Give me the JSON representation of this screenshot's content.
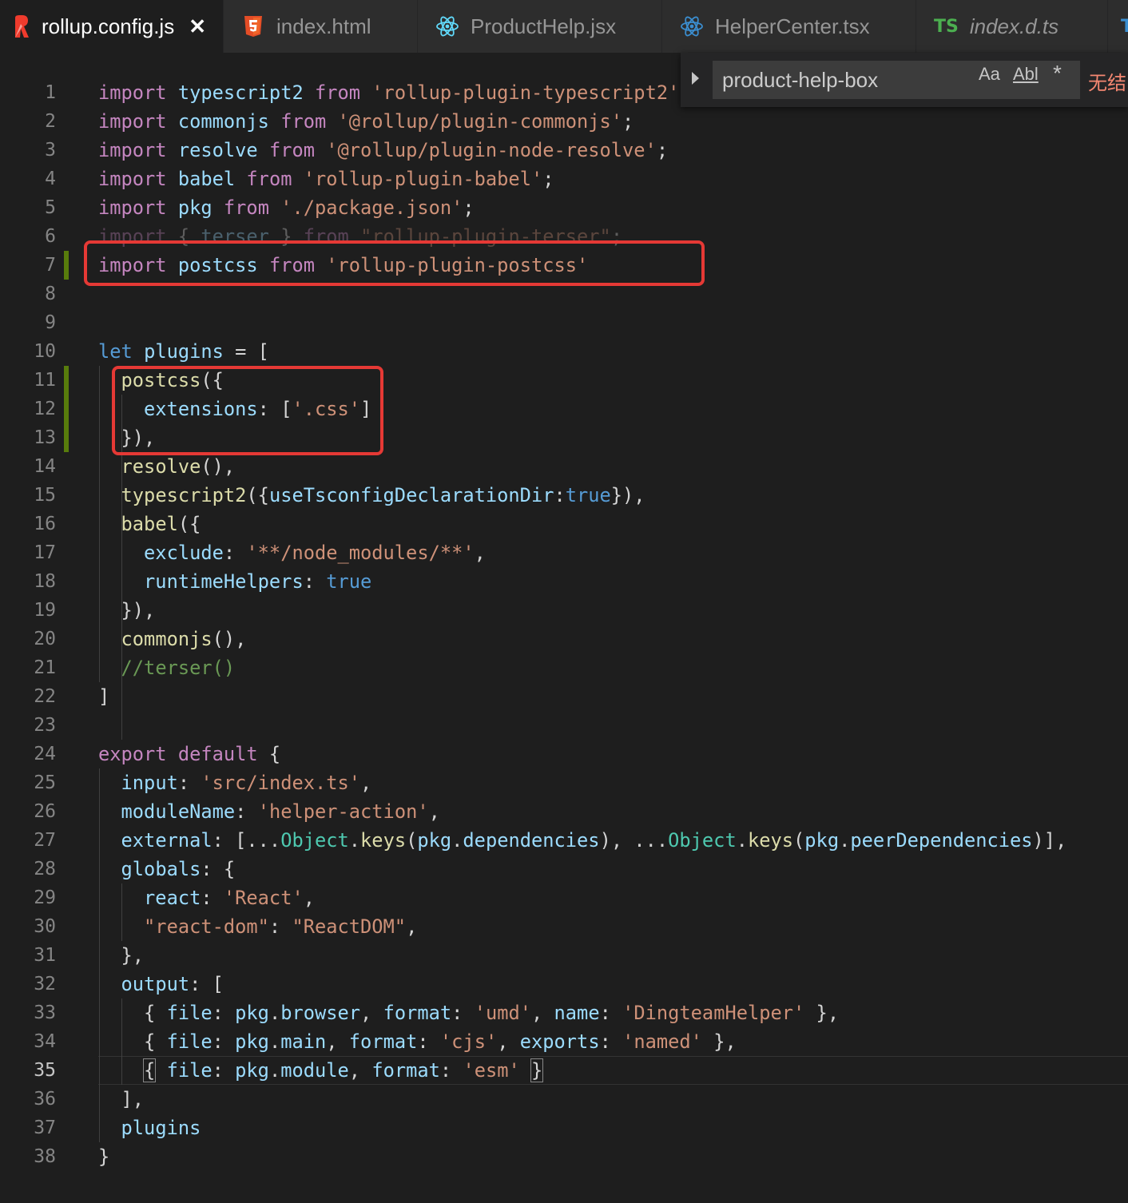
{
  "tabs": [
    {
      "label": "rollup.config.js",
      "icon": "rollup-icon",
      "active": true,
      "close": "✕"
    },
    {
      "label": "index.html",
      "icon": "html5-icon",
      "active": false
    },
    {
      "label": "ProductHelp.jsx",
      "icon": "react-icon",
      "active": false
    },
    {
      "label": "HelperCenter.tsx",
      "icon": "react-icon",
      "active": false
    },
    {
      "label": "index.d.ts",
      "icon": "typescript-icon",
      "badge": "TS",
      "active": false
    },
    {
      "label": "",
      "icon": "typescript-icon",
      "badge": "T",
      "active": false
    }
  ],
  "find": {
    "query": "product-help-box",
    "match_case": "Aa",
    "whole_word": "Abl",
    "regex": "*",
    "result": "无结"
  },
  "lines": [
    {
      "n": "1"
    },
    {
      "n": "2"
    },
    {
      "n": "3"
    },
    {
      "n": "4"
    },
    {
      "n": "5"
    },
    {
      "n": "6"
    },
    {
      "n": "7"
    },
    {
      "n": "8"
    },
    {
      "n": "9"
    },
    {
      "n": "10"
    },
    {
      "n": "11"
    },
    {
      "n": "12"
    },
    {
      "n": "13"
    },
    {
      "n": "14"
    },
    {
      "n": "15"
    },
    {
      "n": "16"
    },
    {
      "n": "17"
    },
    {
      "n": "18"
    },
    {
      "n": "19"
    },
    {
      "n": "20"
    },
    {
      "n": "21"
    },
    {
      "n": "22"
    },
    {
      "n": "23"
    },
    {
      "n": "24"
    },
    {
      "n": "25"
    },
    {
      "n": "26"
    },
    {
      "n": "27"
    },
    {
      "n": "28"
    },
    {
      "n": "29"
    },
    {
      "n": "30"
    },
    {
      "n": "31"
    },
    {
      "n": "32"
    },
    {
      "n": "33"
    },
    {
      "n": "34"
    },
    {
      "n": "35"
    },
    {
      "n": "36"
    },
    {
      "n": "37"
    },
    {
      "n": "38"
    }
  ],
  "current_line": 35,
  "code": [
    [
      [
        "k",
        "import"
      ],
      [
        "p",
        " "
      ],
      [
        "v",
        "typescript2"
      ],
      [
        "p",
        " "
      ],
      [
        "k",
        "from"
      ],
      [
        "p",
        " "
      ],
      [
        "s",
        "'rollup-plugin-typescript2'"
      ]
    ],
    [
      [
        "k",
        "import"
      ],
      [
        "p",
        " "
      ],
      [
        "v",
        "commonjs"
      ],
      [
        "p",
        " "
      ],
      [
        "k",
        "from"
      ],
      [
        "p",
        " "
      ],
      [
        "s",
        "'@rollup/plugin-commonjs'"
      ],
      [
        "p",
        ";"
      ]
    ],
    [
      [
        "k",
        "import"
      ],
      [
        "p",
        " "
      ],
      [
        "v",
        "resolve"
      ],
      [
        "p",
        " "
      ],
      [
        "k",
        "from"
      ],
      [
        "p",
        " "
      ],
      [
        "s",
        "'@rollup/plugin-node-resolve'"
      ],
      [
        "p",
        ";"
      ]
    ],
    [
      [
        "k",
        "import"
      ],
      [
        "p",
        " "
      ],
      [
        "v",
        "babel"
      ],
      [
        "p",
        " "
      ],
      [
        "k",
        "from"
      ],
      [
        "p",
        " "
      ],
      [
        "s",
        "'rollup-plugin-babel'"
      ],
      [
        "p",
        ";"
      ]
    ],
    [
      [
        "k",
        "import"
      ],
      [
        "p",
        " "
      ],
      [
        "v",
        "pkg"
      ],
      [
        "p",
        " "
      ],
      [
        "k",
        "from"
      ],
      [
        "p",
        " "
      ],
      [
        "s",
        "'./package.json'"
      ],
      [
        "p",
        ";"
      ]
    ],
    [
      [
        "k",
        "import"
      ],
      [
        "p",
        " { "
      ],
      [
        "v",
        "terser"
      ],
      [
        "p",
        " } "
      ],
      [
        "k",
        "from"
      ],
      [
        "p",
        " "
      ],
      [
        "s",
        "\"rollup-plugin-terser\""
      ],
      [
        "p",
        ";"
      ]
    ],
    [
      [
        "k",
        "import"
      ],
      [
        "p",
        " "
      ],
      [
        "v",
        "postcss"
      ],
      [
        "p",
        " "
      ],
      [
        "k",
        "from"
      ],
      [
        "p",
        " "
      ],
      [
        "s",
        "'rollup-plugin-postcss'"
      ]
    ],
    [],
    [],
    [
      [
        "kb",
        "let"
      ],
      [
        "p",
        " "
      ],
      [
        "v",
        "plugins"
      ],
      [
        "p",
        " = ["
      ]
    ],
    [
      [
        "p",
        "  "
      ],
      [
        "f",
        "postcss"
      ],
      [
        "p",
        "({"
      ]
    ],
    [
      [
        "p",
        "    "
      ],
      [
        "v",
        "extensions"
      ],
      [
        "p",
        ": ["
      ],
      [
        "s",
        "'.css'"
      ],
      [
        "p",
        "]"
      ]
    ],
    [
      [
        "p",
        "  }),"
      ]
    ],
    [
      [
        "p",
        "  "
      ],
      [
        "f",
        "resolve"
      ],
      [
        "p",
        "(),"
      ]
    ],
    [
      [
        "p",
        "  "
      ],
      [
        "f",
        "typescript2"
      ],
      [
        "p",
        "({"
      ],
      [
        "v",
        "useTsconfigDeclarationDir"
      ],
      [
        "p",
        ":"
      ],
      [
        "kb",
        "true"
      ],
      [
        "p",
        "}),"
      ]
    ],
    [
      [
        "p",
        "  "
      ],
      [
        "f",
        "babel"
      ],
      [
        "p",
        "({"
      ]
    ],
    [
      [
        "p",
        "    "
      ],
      [
        "v",
        "exclude"
      ],
      [
        "p",
        ": "
      ],
      [
        "s",
        "'**/node_modules/**'"
      ],
      [
        "p",
        ","
      ]
    ],
    [
      [
        "p",
        "    "
      ],
      [
        "v",
        "runtimeHelpers"
      ],
      [
        "p",
        ": "
      ],
      [
        "kb",
        "true"
      ]
    ],
    [
      [
        "p",
        "  }),"
      ]
    ],
    [
      [
        "p",
        "  "
      ],
      [
        "f",
        "commonjs"
      ],
      [
        "p",
        "(),"
      ]
    ],
    [
      [
        "p",
        "  "
      ],
      [
        "c",
        "//terser()"
      ]
    ],
    [
      [
        "p",
        "]"
      ]
    ],
    [],
    [
      [
        "k",
        "export"
      ],
      [
        "p",
        " "
      ],
      [
        "k",
        "default"
      ],
      [
        "p",
        " {"
      ]
    ],
    [
      [
        "p",
        "  "
      ],
      [
        "v",
        "input"
      ],
      [
        "p",
        ": "
      ],
      [
        "s",
        "'src/index.ts'"
      ],
      [
        "p",
        ","
      ]
    ],
    [
      [
        "p",
        "  "
      ],
      [
        "v",
        "moduleName"
      ],
      [
        "p",
        ": "
      ],
      [
        "s",
        "'helper-action'"
      ],
      [
        "p",
        ","
      ]
    ],
    [
      [
        "p",
        "  "
      ],
      [
        "v",
        "external"
      ],
      [
        "p",
        ": [..."
      ],
      [
        "t",
        "Object"
      ],
      [
        "p",
        "."
      ],
      [
        "f",
        "keys"
      ],
      [
        "p",
        "("
      ],
      [
        "v",
        "pkg"
      ],
      [
        "p",
        "."
      ],
      [
        "v",
        "dependencies"
      ],
      [
        "p",
        "), ..."
      ],
      [
        "t",
        "Object"
      ],
      [
        "p",
        "."
      ],
      [
        "f",
        "keys"
      ],
      [
        "p",
        "("
      ],
      [
        "v",
        "pkg"
      ],
      [
        "p",
        "."
      ],
      [
        "v",
        "peerDependencies"
      ],
      [
        "p",
        ")],"
      ]
    ],
    [
      [
        "p",
        "  "
      ],
      [
        "v",
        "globals"
      ],
      [
        "p",
        ": {"
      ]
    ],
    [
      [
        "p",
        "    "
      ],
      [
        "v",
        "react"
      ],
      [
        "p",
        ": "
      ],
      [
        "s",
        "'React'"
      ],
      [
        "p",
        ","
      ]
    ],
    [
      [
        "p",
        "    "
      ],
      [
        "s",
        "\"react-dom\""
      ],
      [
        "p",
        ": "
      ],
      [
        "s",
        "\"ReactDOM\""
      ],
      [
        "p",
        ","
      ]
    ],
    [
      [
        "p",
        "  },"
      ]
    ],
    [
      [
        "p",
        "  "
      ],
      [
        "v",
        "output"
      ],
      [
        "p",
        ": ["
      ]
    ],
    [
      [
        "p",
        "    { "
      ],
      [
        "v",
        "file"
      ],
      [
        "p",
        ": "
      ],
      [
        "v",
        "pkg"
      ],
      [
        "p",
        "."
      ],
      [
        "v",
        "browser"
      ],
      [
        "p",
        ", "
      ],
      [
        "v",
        "format"
      ],
      [
        "p",
        ": "
      ],
      [
        "s",
        "'umd'"
      ],
      [
        "p",
        ", "
      ],
      [
        "v",
        "name"
      ],
      [
        "p",
        ": "
      ],
      [
        "s",
        "'DingteamHelper'"
      ],
      [
        "p",
        " },"
      ]
    ],
    [
      [
        "p",
        "    { "
      ],
      [
        "v",
        "file"
      ],
      [
        "p",
        ": "
      ],
      [
        "v",
        "pkg"
      ],
      [
        "p",
        "."
      ],
      [
        "v",
        "main"
      ],
      [
        "p",
        ", "
      ],
      [
        "v",
        "format"
      ],
      [
        "p",
        ": "
      ],
      [
        "s",
        "'cjs'"
      ],
      [
        "p",
        ", "
      ],
      [
        "v",
        "exports"
      ],
      [
        "p",
        ": "
      ],
      [
        "s",
        "'named'"
      ],
      [
        "p",
        " },"
      ]
    ],
    [
      [
        "p",
        "    "
      ],
      [
        "b",
        "{"
      ],
      [
        "p",
        " "
      ],
      [
        "v",
        "file"
      ],
      [
        "p",
        ": "
      ],
      [
        "v",
        "pkg"
      ],
      [
        "p",
        "."
      ],
      [
        "v",
        "module"
      ],
      [
        "p",
        ", "
      ],
      [
        "v",
        "format"
      ],
      [
        "p",
        ": "
      ],
      [
        "s",
        "'esm'"
      ],
      [
        "p",
        " "
      ],
      [
        "b",
        "}"
      ]
    ],
    [
      [
        "p",
        "  ],"
      ]
    ],
    [
      [
        "p",
        "  "
      ],
      [
        "v",
        "plugins"
      ]
    ],
    [
      [
        "p",
        "}"
      ]
    ]
  ]
}
